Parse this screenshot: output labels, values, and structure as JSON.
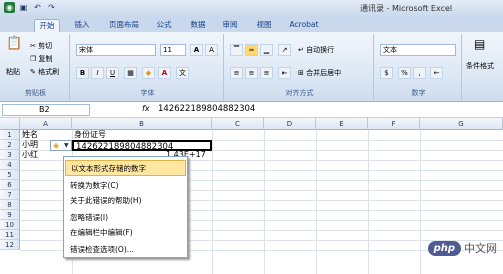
{
  "window": {
    "title": "通讯录 - Microsoft Excel"
  },
  "tabs": [
    "开始",
    "插入",
    "页面布局",
    "公式",
    "数据",
    "审阅",
    "视图",
    "Acrobat"
  ],
  "clipboard": {
    "paste": "粘贴",
    "cut": "剪切",
    "copy": "复制",
    "format_painter": "格式刷",
    "label": "剪贴板"
  },
  "font": {
    "name": "宋体",
    "size": "11",
    "grow": "A",
    "shrink": "A",
    "bold": "B",
    "italic": "I",
    "underline": "U",
    "label": "字体"
  },
  "alignment": {
    "wrap": "自动换行",
    "merge": "合并后居中",
    "label": "对齐方式"
  },
  "number": {
    "format": "文本",
    "percent": "%",
    "comma": ",",
    "label": "数字"
  },
  "styles": {
    "conditional": "条件格式"
  },
  "formula_bar": {
    "name_box": "B2",
    "fx": "fx",
    "value": "142622189804882304"
  },
  "columns": [
    "A",
    "B",
    "C",
    "D",
    "E",
    "F",
    "G"
  ],
  "rows": [
    "1",
    "2",
    "3",
    "4",
    "5",
    "6",
    "7",
    "8",
    "9",
    "10",
    "11",
    "12"
  ],
  "cells": {
    "a1": "姓名",
    "b1": "身份证号",
    "a2": "小明",
    "b2": "142622189804882304",
    "a3": "小红",
    "b3": "1.43E+17"
  },
  "error_menu": [
    "以文本形式存储的数字",
    "转换为数字(C)",
    "关于此错误的帮助(H)",
    "忽略错误(I)",
    "在编辑栏中编辑(F)",
    "错误检查选项(O)..."
  ],
  "watermark": {
    "badge": "php",
    "text": "中文网"
  }
}
